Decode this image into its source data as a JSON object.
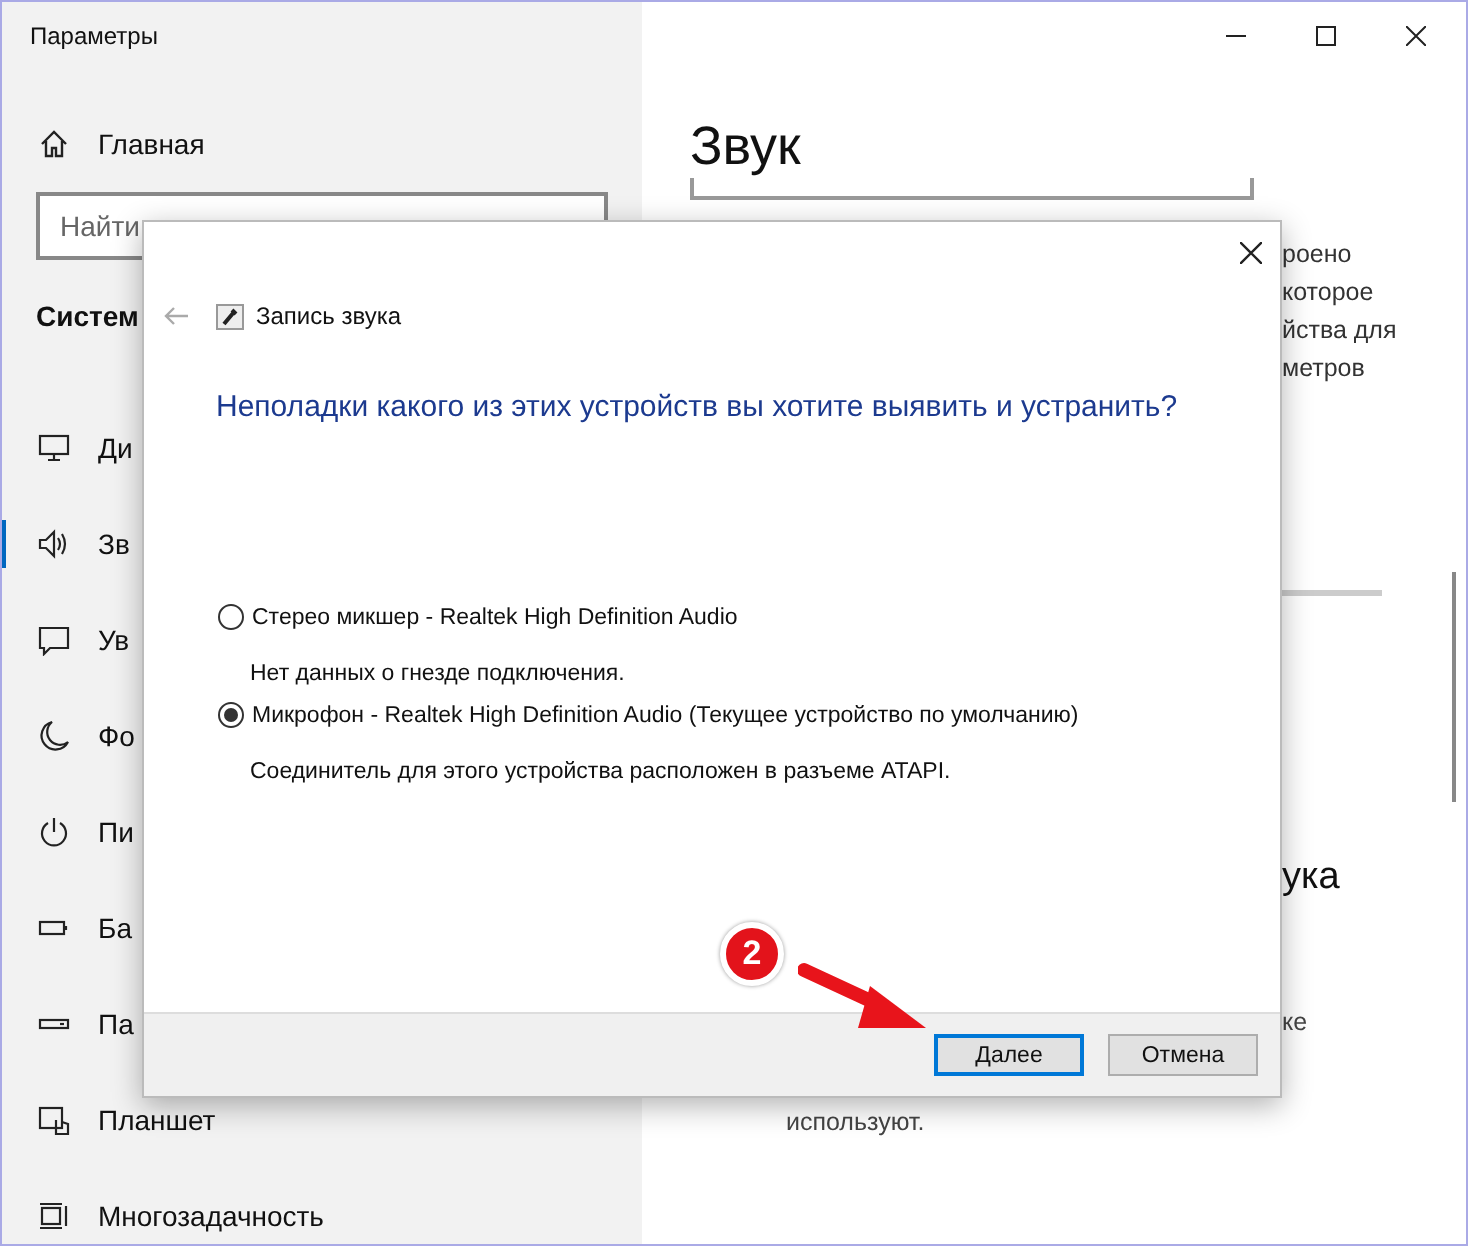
{
  "window": {
    "title": "Параметры"
  },
  "sidebar": {
    "home": "Главная",
    "search": {
      "placeholder": "Найти"
    },
    "section": "Систем",
    "items": [
      {
        "label": "Ди",
        "selected": false
      },
      {
        "label": "Зв",
        "selected": true
      },
      {
        "label": "Ув",
        "selected": false
      },
      {
        "label": "Фо",
        "selected": false
      },
      {
        "label": "Пи",
        "selected": false
      },
      {
        "label": "Ба",
        "selected": false
      },
      {
        "label": "Па",
        "selected": false
      },
      {
        "label": "Планшет",
        "selected": false
      },
      {
        "label": "Многозадачность",
        "selected": false
      }
    ]
  },
  "main": {
    "title": "Звук",
    "paragraph_lines": [
      "роено",
      "которое",
      "йства для",
      "метров"
    ],
    "heading_fragment": "ука",
    "line_fragment": "ке",
    "text_fragment": "используют."
  },
  "dialog": {
    "title": "Запись звука",
    "question": "Неполадки какого из этих устройств вы хотите выявить и устранить?",
    "options": [
      {
        "label": "Стерео микшер - Realtek High Definition Audio",
        "note": "Нет данных о гнезде подключения.",
        "selected": false
      },
      {
        "label": "Микрофон - Realtek High Definition Audio (Текущее устройство по умолчанию)",
        "note": "Соединитель для этого устройства расположен в разъеме ATAPI.",
        "selected": true
      }
    ],
    "buttons": [
      {
        "label": "Далее",
        "default": true
      },
      {
        "label": "Отмена",
        "default": false
      }
    ]
  },
  "annotation": {
    "badge": "2"
  }
}
